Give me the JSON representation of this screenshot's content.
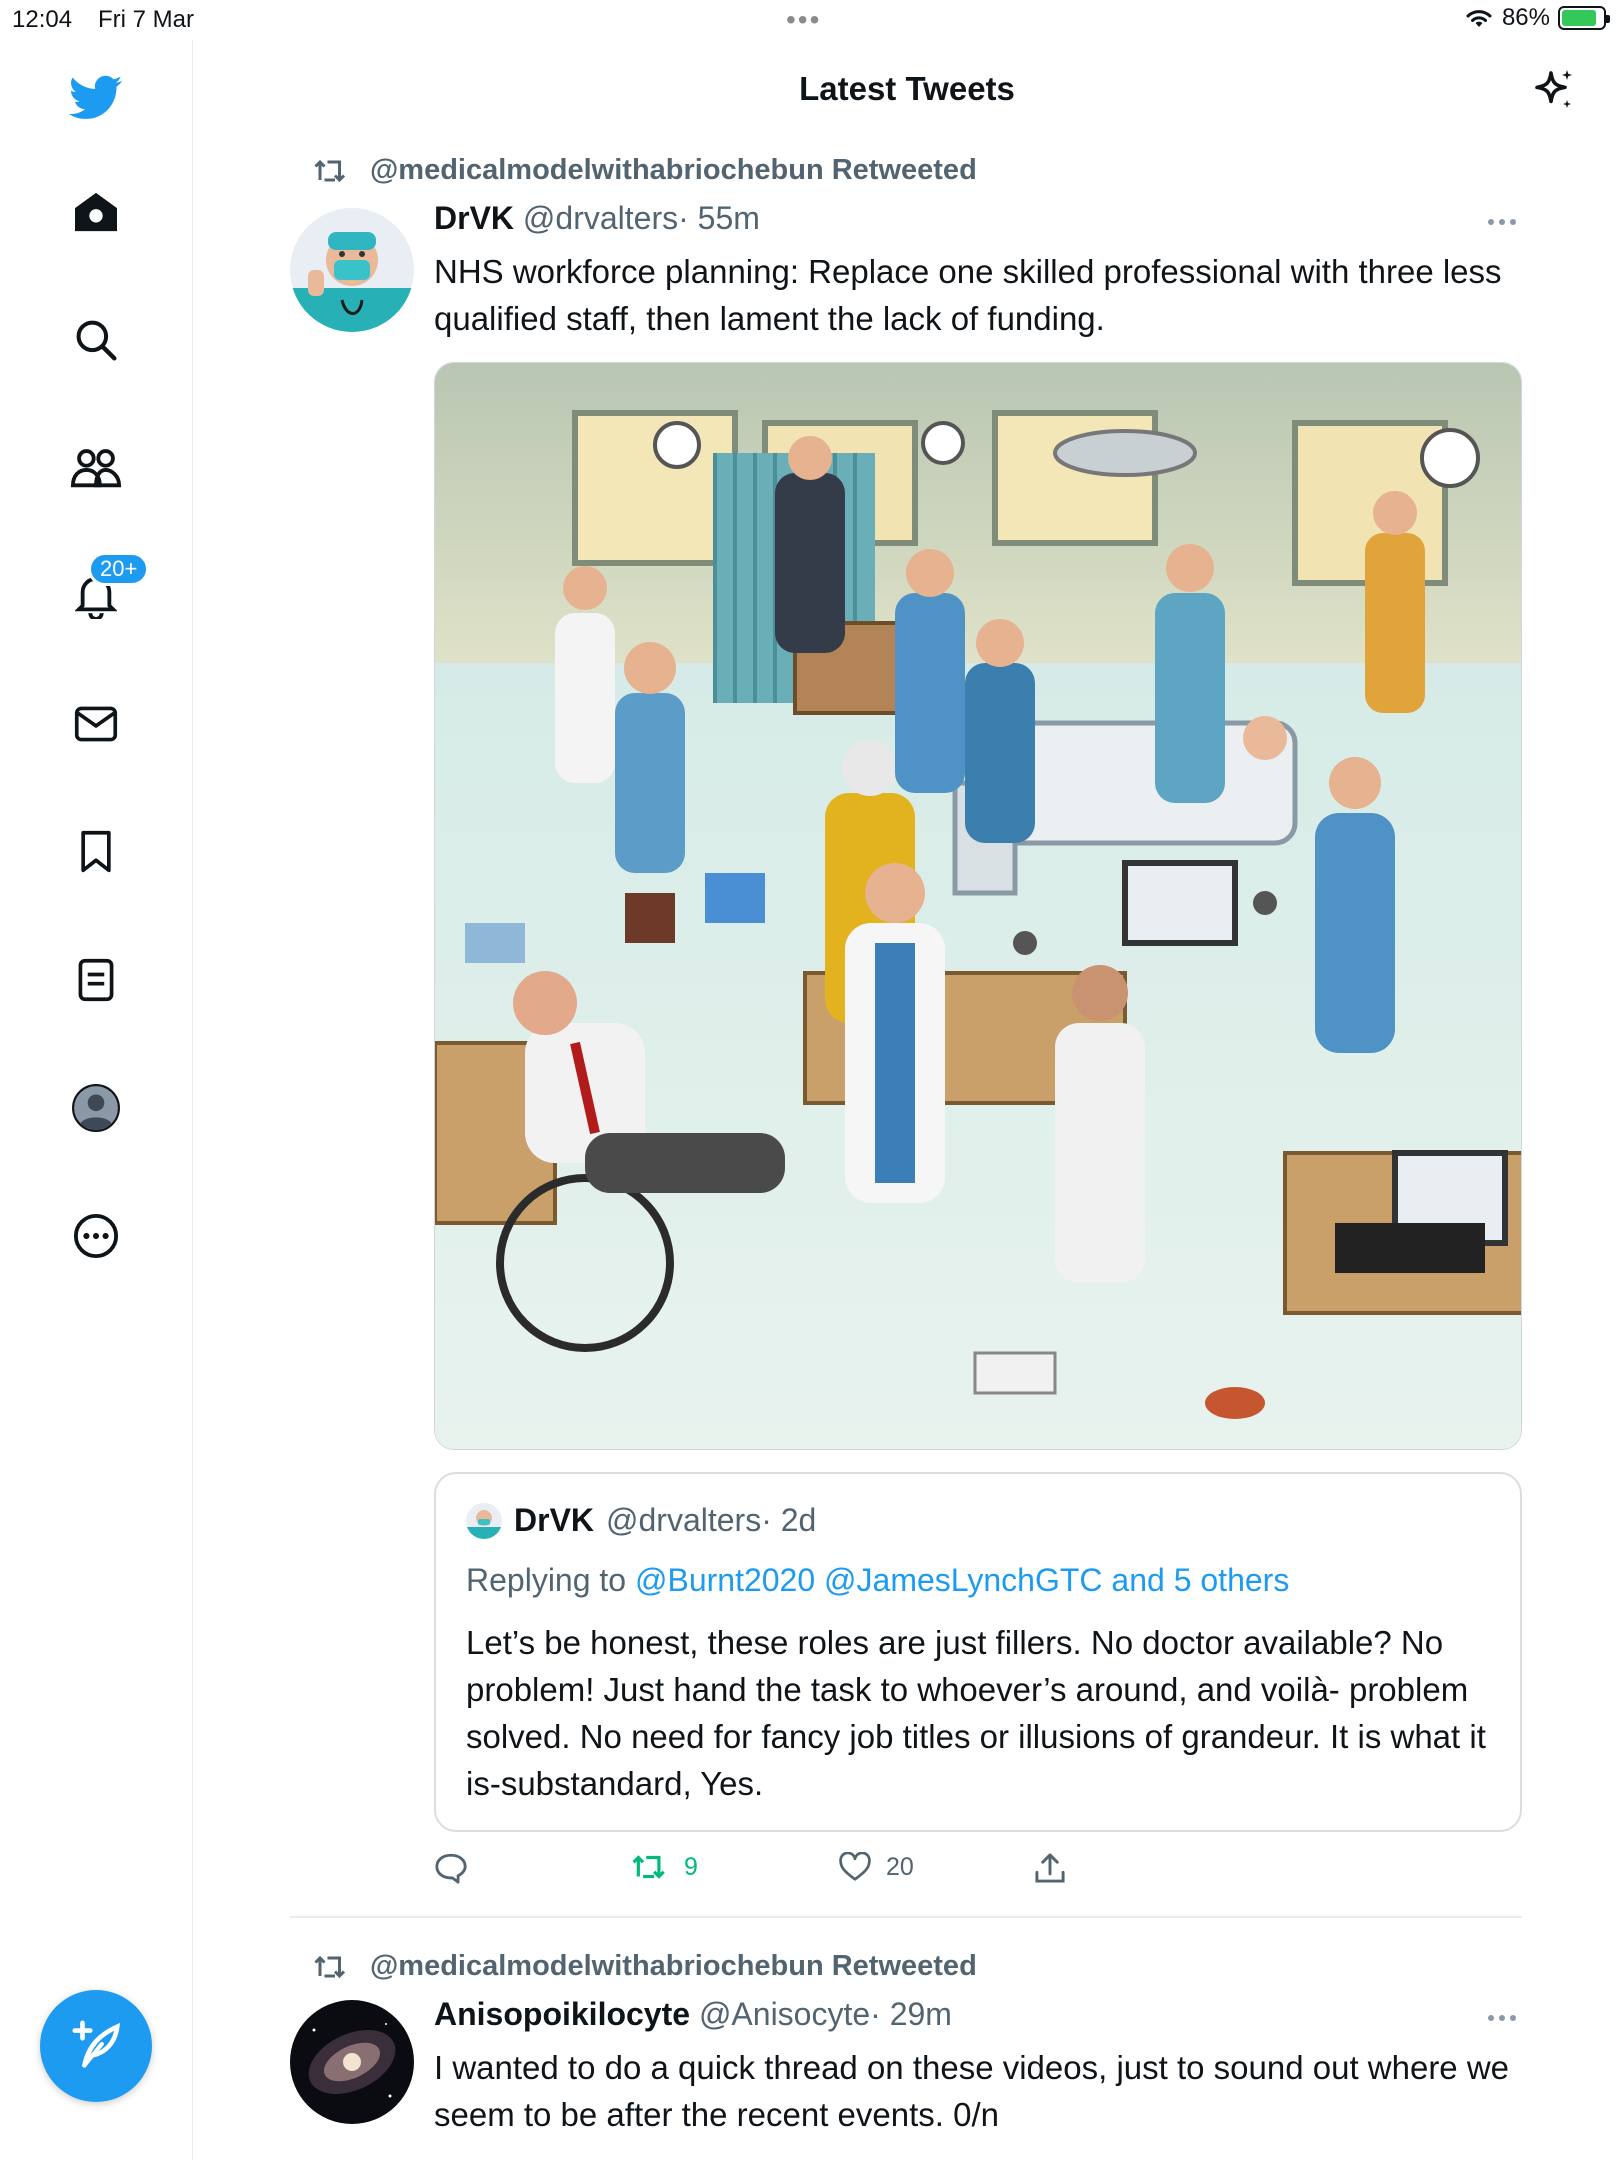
{
  "status_bar": {
    "time": "12:04",
    "date": "Fri 7 Mar",
    "battery": "86%",
    "battery_level": 0.86
  },
  "sidebar": {
    "notifications_badge": "20+",
    "items": [
      "home-icon",
      "search-icon",
      "communities-icon",
      "notifications-icon",
      "messages-icon",
      "bookmarks-icon",
      "lists-icon",
      "profile-icon",
      "more-icon"
    ]
  },
  "header": {
    "title": "Latest Tweets"
  },
  "tweets": [
    {
      "retweeted_by": "@medicalmodelwithabriochebun Retweeted",
      "name": "DrVK",
      "handle": "@drvalters",
      "time": "· 55m",
      "text": "NHS workforce planning: Replace one skilled professional with three less qualified staff, then lament the lack of funding.",
      "quote": {
        "name": "DrVK",
        "handle": "@drvalters",
        "time": "· 2d",
        "replying_prefix": "Replying to ",
        "replying_links": "@Burnt2020 @JamesLynchGTC and 5 others",
        "text": "Let’s be honest, these roles are just fillers. No doctor available? No problem! Just hand the task to whoever’s around, and voilà- problem solved. No need for fancy job titles or illusions of grandeur. It is what it is-substandard, Yes."
      },
      "retweets": "9",
      "likes": "20"
    },
    {
      "retweeted_by": "@medicalmodelwithabriochebun Retweeted",
      "name": "Anisopoikilocyte",
      "handle": "@Anisocyte",
      "time": "· 29m",
      "text": "I wanted to do a quick thread on these videos, just to sound out where we seem to be after the recent events. 0/n"
    }
  ],
  "colors": {
    "accent": "#1d9bf0",
    "retweet_green": "#00ba7c",
    "secondary_text": "#536471"
  }
}
